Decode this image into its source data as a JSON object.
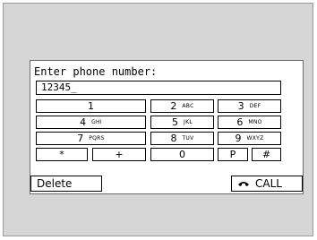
{
  "dialog": {
    "prompt": "Enter phone number:",
    "number_value": "12345_"
  },
  "keypad": {
    "keys": [
      {
        "digit": "1",
        "letters": ""
      },
      {
        "digit": "2",
        "letters": "ABC"
      },
      {
        "digit": "3",
        "letters": "DEF"
      },
      {
        "digit": "4",
        "letters": "GHI"
      },
      {
        "digit": "5",
        "letters": "JKL"
      },
      {
        "digit": "6",
        "letters": "MNO"
      },
      {
        "digit": "7",
        "letters": "PQRS"
      },
      {
        "digit": "8",
        "letters": "TUV"
      },
      {
        "digit": "9",
        "letters": "WXYZ"
      },
      {
        "digit": "*",
        "letters": ""
      },
      {
        "digit": "+",
        "letters": ""
      },
      {
        "digit": "0",
        "letters": ""
      },
      {
        "digit": "P",
        "letters": ""
      },
      {
        "digit": "#",
        "letters": ""
      }
    ]
  },
  "actions": {
    "delete_label": "Delete",
    "call_label": "CALL",
    "call_icon": "phone-handset-icon"
  }
}
